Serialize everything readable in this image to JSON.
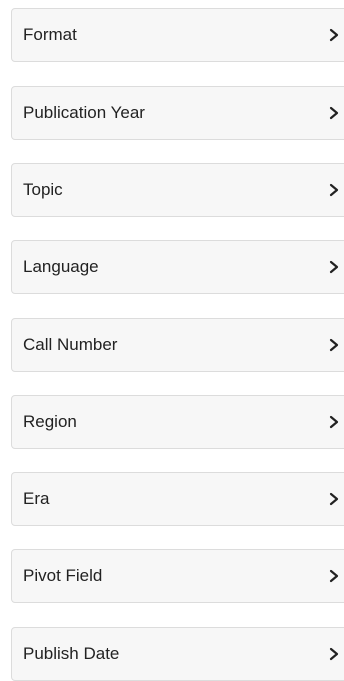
{
  "facets": {
    "items": [
      {
        "label": "Format",
        "icon": "chevron-right-icon",
        "expanded": false
      },
      {
        "label": "Publication Year",
        "icon": "chevron-right-icon",
        "expanded": false
      },
      {
        "label": "Topic",
        "icon": "chevron-right-icon",
        "expanded": false
      },
      {
        "label": "Language",
        "icon": "chevron-right-icon",
        "expanded": false
      },
      {
        "label": "Call Number",
        "icon": "chevron-right-icon",
        "expanded": false
      },
      {
        "label": "Region",
        "icon": "chevron-right-icon",
        "expanded": false
      },
      {
        "label": "Era",
        "icon": "chevron-right-icon",
        "expanded": false
      },
      {
        "label": "Pivot Field",
        "icon": "chevron-right-icon",
        "expanded": false
      },
      {
        "label": "Publish Date",
        "icon": "chevron-right-icon",
        "expanded": false
      }
    ],
    "colors": {
      "panel_background": "#f7f7f7",
      "panel_border": "#dcdcdc",
      "text": "#222222"
    }
  }
}
